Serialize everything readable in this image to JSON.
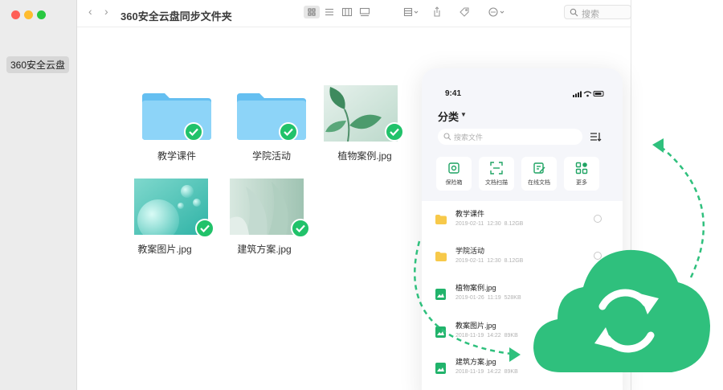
{
  "window": {
    "title": "360安全云盘同步文件夹",
    "sidebar_item": "360安全云盘",
    "search_placeholder": "搜索"
  },
  "files": [
    {
      "name": "教学课件",
      "kind": "folder"
    },
    {
      "name": "学院活动",
      "kind": "folder"
    },
    {
      "name": "植物案例.jpg",
      "kind": "image"
    },
    {
      "name": "教案图片.jpg",
      "kind": "image"
    },
    {
      "name": "建筑方案.jpg",
      "kind": "image"
    }
  ],
  "phone": {
    "time": "9:41",
    "category_label": "分类",
    "search_placeholder": "搜索文件",
    "tiles": [
      "保险箱",
      "文档扫描",
      "在线文档",
      "更多"
    ],
    "rows": [
      {
        "name": "教学课件",
        "date": "2019-02-11",
        "time": "12:30",
        "size": "8.12GB",
        "icon": "folder-icon"
      },
      {
        "name": "学院活动",
        "date": "2019-02-11",
        "time": "12:30",
        "size": "8.12GB",
        "icon": "folder-icon"
      },
      {
        "name": "植物案例.jpg",
        "date": "2019-01-26",
        "time": "11:19",
        "size": "528KB",
        "icon": "image-file-icon"
      },
      {
        "name": "教案图片.jpg",
        "date": "2018-11-19",
        "time": "14:22",
        "size": "89KB",
        "icon": "image-file-icon"
      },
      {
        "name": "建筑方案.jpg",
        "date": "2018-11-19",
        "time": "14:22",
        "size": "89KB",
        "icon": "image-file-icon"
      }
    ]
  },
  "colors": {
    "accent_green": "#21c26a",
    "cloud_green": "#2fc07d",
    "folder_blue": "#7fcdf5",
    "folder_yellow": "#f7c94a"
  }
}
